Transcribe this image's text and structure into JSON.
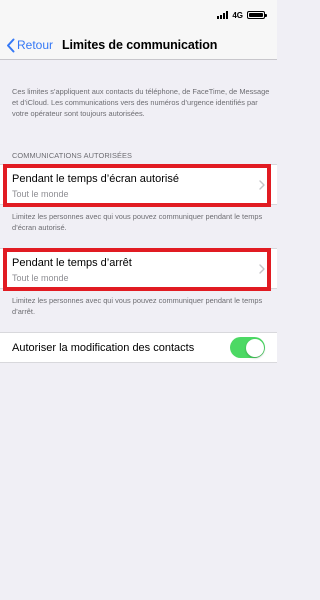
{
  "status_bar": {
    "network": "4G",
    "icons": [
      "signal-icon",
      "battery-icon"
    ]
  },
  "nav": {
    "back_label": "Retour",
    "title": "Limites de communication",
    "back_icon": "chevron-left-icon"
  },
  "intro_text": "Ces limites s’appliquent aux contacts du téléphone, de FaceTime, de Message et d’iCloud. Les communications vers des numéros d’urgence identifiés par votre opérateur sont toujours autorisées.",
  "section_header": "COMMUNICATIONS AUTORISÉES",
  "cells": [
    {
      "title": "Pendant le temps d’écran autorisé",
      "subtitle": "Tout le monde",
      "footer": "Limitez les personnes avec qui vous pouvez communiquer pendant le temps d’écran autorisé."
    },
    {
      "title": "Pendant le temps d’arrêt",
      "subtitle": "Tout le monde",
      "footer": "Limitez les personnes avec qui vous pouvez communiquer pendant le temps d’arrêt."
    }
  ],
  "toggle_row": {
    "label": "Autoriser la modification des contacts",
    "state": "on"
  },
  "colors": {
    "accent": "#3478f6",
    "highlight": "#e11b22",
    "toggle_on": "#4cd964",
    "background": "#f0eff5"
  }
}
